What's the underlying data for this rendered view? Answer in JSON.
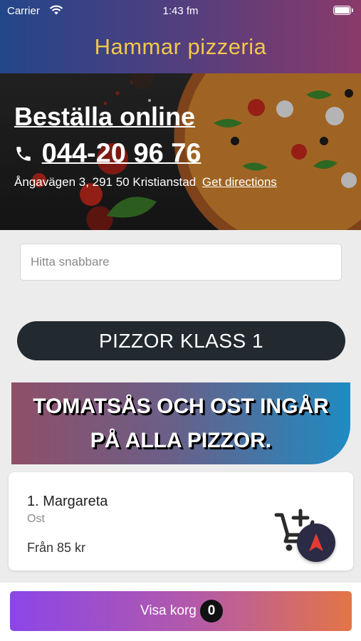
{
  "status_bar": {
    "carrier": "Carrier",
    "time": "1:43 fm"
  },
  "header": {
    "title": "Hammar pizzeria"
  },
  "hero": {
    "order_online": "Beställa online",
    "phone": "044-20 96 76",
    "address": "Ångavägen 3, 291 50 Kristianstad",
    "directions_link": "Get directions"
  },
  "search": {
    "placeholder": "Hitta snabbare"
  },
  "category": {
    "label": "PIZZOR KLASS 1"
  },
  "banner": {
    "line1": "TOMATSÅS OCH OST INGÅR",
    "line2": "PÅ ALLA PIZZOR."
  },
  "products": [
    {
      "name": "1. Margareta",
      "description": "Ost",
      "price": "Från 85 kr"
    }
  ],
  "cart": {
    "label": "Visa korg",
    "count": "0"
  },
  "colors": {
    "header_title": "#f3c84a",
    "category_bg": "#222a30",
    "fab_bg": "#2c2b45",
    "fab_arrow": "#e53935",
    "cart_gradient_start": "#8b46e8",
    "cart_gradient_end": "#e37546"
  }
}
